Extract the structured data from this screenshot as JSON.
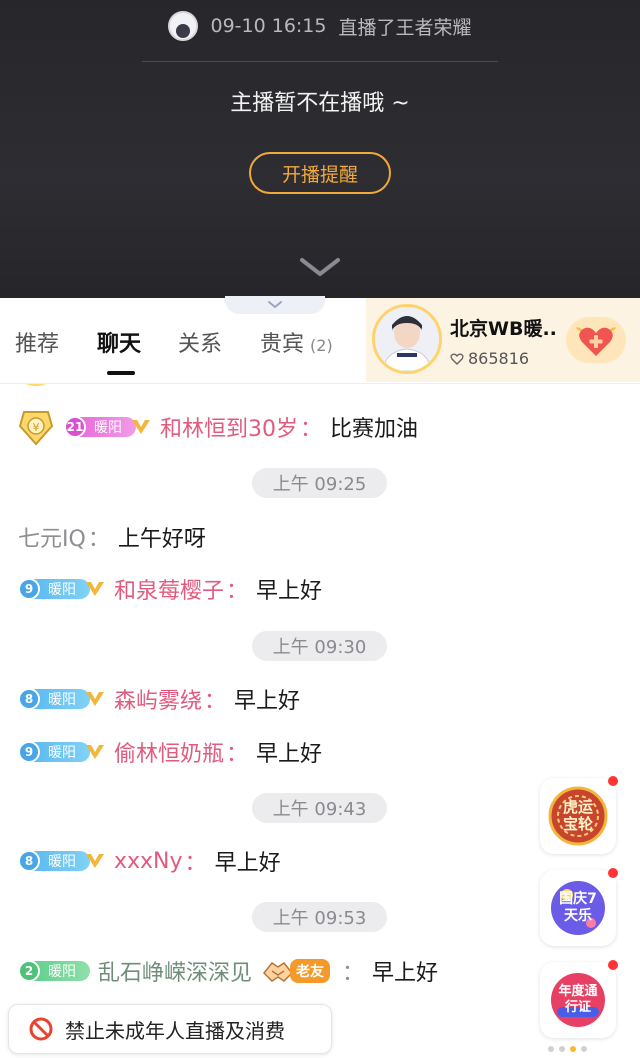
{
  "player": {
    "replay_time": "09-10 16:15",
    "replay_text": "直播了王者荣耀",
    "offline_text": "主播暂不在播哦 ~",
    "remind_button": "开播提醒"
  },
  "tabs": [
    {
      "label": "推荐",
      "active": false
    },
    {
      "label": "聊天",
      "active": true
    },
    {
      "label": "关系",
      "active": false
    },
    {
      "label": "贵宾",
      "active": false,
      "count": "(2)"
    }
  ],
  "anchor": {
    "name": "北京WB暖..",
    "fans": "865816",
    "follow_icon": "heart-plus-icon"
  },
  "chat": {
    "messages": [
      {
        "badge_level": "21",
        "badge_name": "暖阳",
        "badge_color": "pink",
        "nick": "和林恒到30岁",
        "text": "比赛加油"
      },
      {
        "time": "上午 09:25"
      },
      {
        "nick": "七元IQ",
        "text": "上午好呀"
      },
      {
        "badge_level": "9",
        "badge_name": "暖阳",
        "badge_color": "blue",
        "nick": "和泉莓樱子",
        "text": "早上好"
      },
      {
        "time": "上午 09:30"
      },
      {
        "badge_level": "8",
        "badge_name": "暖阳",
        "badge_color": "blue",
        "nick": "森屿雾绕",
        "text": "早上好"
      },
      {
        "badge_level": "9",
        "badge_name": "暖阳",
        "badge_color": "blue",
        "nick": "偷林恒奶瓶",
        "text": "早上好"
      },
      {
        "time": "上午 09:43"
      },
      {
        "badge_level": "8",
        "badge_name": "暖阳",
        "badge_color": "blue",
        "nick": "xxxNy",
        "text": "早上好"
      },
      {
        "time": "上午 09:53"
      },
      {
        "badge_level": "2",
        "badge_name": "暖阳",
        "badge_color": "green",
        "nick": "乱石峥嵘深深见",
        "tag": "老友",
        "text": "早上好"
      }
    ]
  },
  "side_events": [
    {
      "label": "虎运宝轮"
    },
    {
      "label": "国庆7天乐"
    },
    {
      "label": "年度通行证"
    }
  ],
  "notice": {
    "text": "禁止未成年人直播及消费",
    "icon": "prohibited-icon"
  },
  "colors": {
    "accent": "#f2a93b",
    "nick_pink": "#e25a7e",
    "player_bg": "#2b2b30"
  }
}
